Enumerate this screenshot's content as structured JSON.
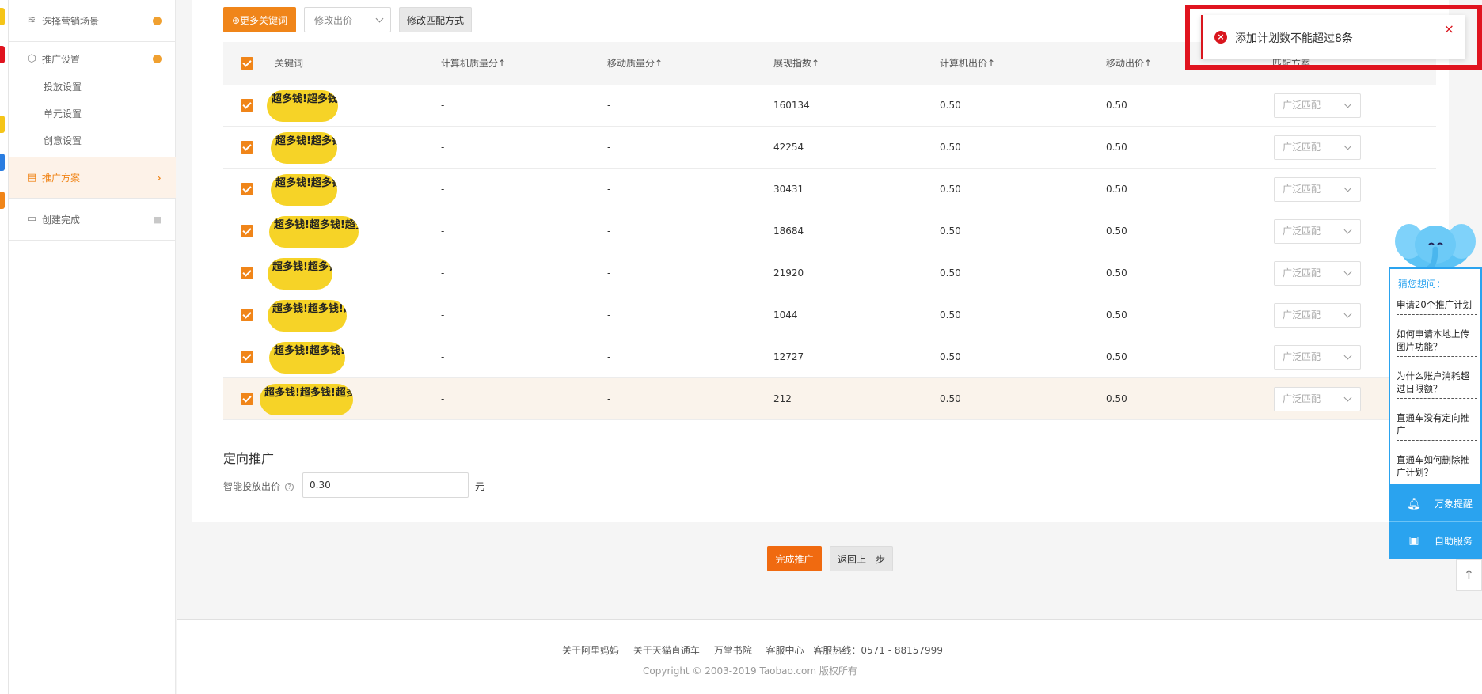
{
  "app_strip_colors": [
    "#f5c518",
    "#e0141f",
    "#f5c518",
    "#2a7de1",
    "#f08519"
  ],
  "sidebar": {
    "steps": [
      {
        "label": "选择营销场景",
        "icon": "layers-icon",
        "state": "done"
      },
      {
        "label": "推广设置",
        "icon": "hexagon-icon",
        "state": "done"
      },
      {
        "label": "推广方案",
        "icon": "document-icon",
        "state": "active"
      },
      {
        "label": "创建完成",
        "icon": "folder-icon",
        "state": "locked"
      }
    ],
    "sub_items": [
      "投放设置",
      "单元设置",
      "创意设置"
    ]
  },
  "toolbar": {
    "more_keywords": "⊕更多关键词",
    "modify_bid": "修改出价",
    "modify_match": "修改匹配方式"
  },
  "table": {
    "headers": [
      "关键词",
      "计算机质量分↑",
      "移动质量分↑",
      "展现指数↑",
      "计算机出价↑",
      "移动出价↑",
      "匹配方案"
    ],
    "rows": [
      {
        "pc_quality": "-",
        "mobile_quality": "-",
        "impressions": "160134",
        "pc_bid": "0.50",
        "mobile_bid": "0.50",
        "match": "广泛匹配"
      },
      {
        "pc_quality": "-",
        "mobile_quality": "-",
        "impressions": "42254",
        "pc_bid": "0.50",
        "mobile_bid": "0.50",
        "match": "广泛匹配"
      },
      {
        "pc_quality": "-",
        "mobile_quality": "-",
        "impressions": "30431",
        "pc_bid": "0.50",
        "mobile_bid": "0.50",
        "match": "广泛匹配"
      },
      {
        "pc_quality": "-",
        "mobile_quality": "-",
        "impressions": "18684",
        "pc_bid": "0.50",
        "mobile_bid": "0.50",
        "match": "广泛匹配"
      },
      {
        "pc_quality": "-",
        "mobile_quality": "-",
        "impressions": "21920",
        "pc_bid": "0.50",
        "mobile_bid": "0.50",
        "match": "广泛匹配"
      },
      {
        "pc_quality": "-",
        "mobile_quality": "-",
        "impressions": "1044",
        "pc_bid": "0.50",
        "mobile_bid": "0.50",
        "match": "广泛匹配"
      },
      {
        "pc_quality": "-",
        "mobile_quality": "-",
        "impressions": "12727",
        "pc_bid": "0.50",
        "mobile_bid": "0.50",
        "match": "广泛匹配"
      },
      {
        "pc_quality": "-",
        "mobile_quality": "-",
        "impressions": "212",
        "pc_bid": "0.50",
        "mobile_bid": "0.50",
        "match": "广泛匹配"
      }
    ],
    "redaction_text": "超多钱!超多钱!超多钱!"
  },
  "targeting": {
    "title": "定向推广",
    "bid_label": "智能投放出价",
    "bid_value": "0.30",
    "unit": "元"
  },
  "actions": {
    "finish": "完成推广",
    "back": "返回上一步"
  },
  "footer": {
    "links": [
      "关于阿里妈妈",
      "关于天猫直通车",
      "万堂书院",
      "客服中心",
      "客服热线：0571 - 88157999"
    ],
    "copyright": "Copyright © 2003-2019 Taobao.com 版权所有"
  },
  "toast": {
    "message": "添加计划数不能超过8条",
    "close": "×"
  },
  "help": {
    "heading": "猜您想问：",
    "questions": [
      "申请20个推广计划",
      "如何申请本地上传图片功能？",
      "为什么账户消耗超过日限额？",
      "直通车没有定向推广",
      "直通车如何删除推广计划？"
    ],
    "buttons": [
      {
        "label": "万象提醒",
        "icon": "bell-icon"
      },
      {
        "label": "自助服务",
        "icon": "chat-icon"
      }
    ],
    "to_top_icon": "arrow-up-icon"
  }
}
